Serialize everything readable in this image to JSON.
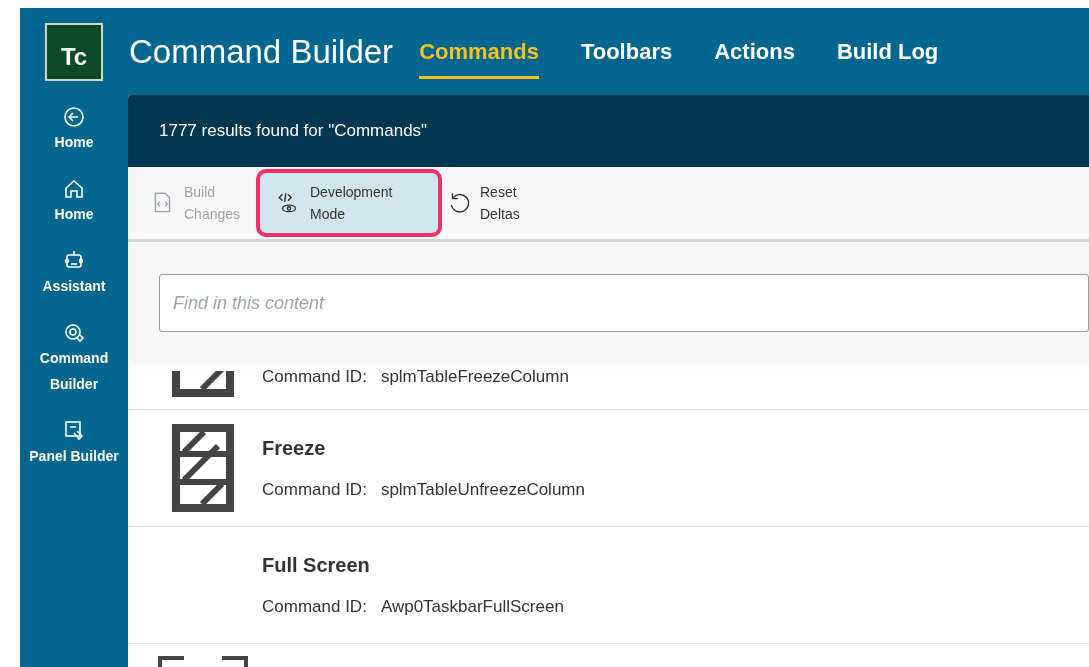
{
  "app": {
    "logo": "Tc",
    "title": "Command Builder"
  },
  "tabs": [
    {
      "label": "Commands",
      "selected": true
    },
    {
      "label": "Toolbars",
      "selected": false
    },
    {
      "label": "Actions",
      "selected": false
    },
    {
      "label": "Build Log",
      "selected": false
    }
  ],
  "sidebar": {
    "items": [
      {
        "kind": "back",
        "label": "Home"
      },
      {
        "kind": "house",
        "label": "Home"
      },
      {
        "kind": "robot",
        "label": "Assistant"
      },
      {
        "kind": "builder",
        "label": "Command Builder"
      },
      {
        "kind": "panel",
        "label": "Panel Builder"
      }
    ]
  },
  "results_banner": "1777 results found for \"Commands\"",
  "toolbar": [
    {
      "kind": "build",
      "label": "Build Changes",
      "disabled": true,
      "selected": false
    },
    {
      "kind": "dev",
      "label": "Development Mode",
      "disabled": false,
      "selected": true
    },
    {
      "kind": "reset",
      "label": "Reset Deltas",
      "disabled": false,
      "selected": false
    }
  ],
  "search": {
    "placeholder": "Find in this content"
  },
  "commands": [
    {
      "kind": "partial",
      "id_label": "Command ID:",
      "id": "splmTableFreezeColumn"
    },
    {
      "kind": "freeze",
      "name": "Freeze",
      "id_label": "Command ID:",
      "id": "splmTableUnfreezeColumn"
    },
    {
      "kind": "plain",
      "name": "Full Screen",
      "id_label": "Command ID:",
      "id": "Awp0TaskbarFullScreen"
    },
    {
      "kind": "icon_only"
    }
  ]
}
